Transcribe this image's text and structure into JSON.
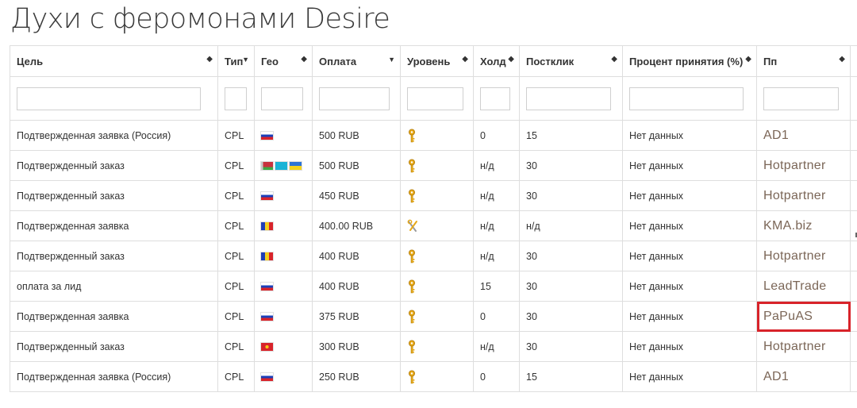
{
  "page": {
    "title": "Духи с феромонами Desire"
  },
  "table": {
    "columns": [
      {
        "label": "Цель",
        "sort": "both"
      },
      {
        "label": "Тип",
        "sort": "desc"
      },
      {
        "label": "Гео",
        "sort": "both"
      },
      {
        "label": "Оплата",
        "sort": "desc"
      },
      {
        "label": "Уровень",
        "sort": "both"
      },
      {
        "label": "Холд",
        "sort": "both"
      },
      {
        "label": "Постклик",
        "sort": "both"
      },
      {
        "label": "Процент принятия (%)",
        "sort": "both"
      },
      {
        "label": "Пп",
        "sort": "both"
      }
    ],
    "sort_icons": {
      "both": "◆",
      "desc": "▼"
    },
    "rows": [
      {
        "goal": "Подтвержденная заявка (Россия)",
        "type": "CPL",
        "flags": [
          "ru"
        ],
        "payment": "500 RUB",
        "level_icon": "key-icon",
        "hold": "0",
        "postclick": "15",
        "acceptance": "Нет данных",
        "partner": "AD1"
      },
      {
        "goal": "Подтвержденный заказ",
        "type": "CPL",
        "flags": [
          "by",
          "kz",
          "ua"
        ],
        "payment": "500 RUB",
        "level_icon": "key-icon",
        "hold": "н/д",
        "postclick": "30",
        "acceptance": "Нет данных",
        "partner": "Hotpartner"
      },
      {
        "goal": "Подтвержденный заказ",
        "type": "CPL",
        "flags": [
          "ru"
        ],
        "payment": "450 RUB",
        "level_icon": "key-icon",
        "hold": "н/д",
        "postclick": "30",
        "acceptance": "Нет данных",
        "partner": "Hotpartner"
      },
      {
        "goal": "Подтвержденная заявка",
        "type": "CPL",
        "flags": [
          "md"
        ],
        "payment": "400.00 RUB",
        "level_icon": "tools-icon",
        "hold": "н/д",
        "postclick": "н/д",
        "acceptance": "Нет данных",
        "partner": "KMA.biz"
      },
      {
        "goal": "Подтвержденный заказ",
        "type": "CPL",
        "flags": [
          "ro"
        ],
        "payment": "400 RUB",
        "level_icon": "key-icon",
        "hold": "н/д",
        "postclick": "30",
        "acceptance": "Нет данных",
        "partner": "Hotpartner"
      },
      {
        "goal": "оплата за лид",
        "type": "CPL",
        "flags": [
          "ru"
        ],
        "payment": "400 RUB",
        "level_icon": "key-icon",
        "hold": "15",
        "postclick": "30",
        "acceptance": "Нет данных",
        "partner": "LeadTrade"
      },
      {
        "goal": "Подтвержденная заявка",
        "type": "CPL",
        "flags": [
          "ru"
        ],
        "payment": "375 RUB",
        "level_icon": "key-icon",
        "hold": "0",
        "postclick": "30",
        "acceptance": "Нет данных",
        "partner": "PaPuAS",
        "highlighted": true
      },
      {
        "goal": "Подтвержденный заказ",
        "type": "CPL",
        "flags": [
          "kg"
        ],
        "payment": "300 RUB",
        "level_icon": "key-icon",
        "hold": "н/д",
        "postclick": "30",
        "acceptance": "Нет данных",
        "partner": "Hotpartner"
      },
      {
        "goal": "Подтвержденная заявка (Россия)",
        "type": "CPL",
        "flags": [
          "ru"
        ],
        "payment": "250 RUB",
        "level_icon": "key-icon",
        "hold": "0",
        "postclick": "15",
        "acceptance": "Нет данных",
        "partner": "AD1"
      }
    ],
    "colors": {
      "partner_text": "#7b6657",
      "highlight_border": "#d8232a",
      "key_gold": "#e6a817"
    }
  }
}
